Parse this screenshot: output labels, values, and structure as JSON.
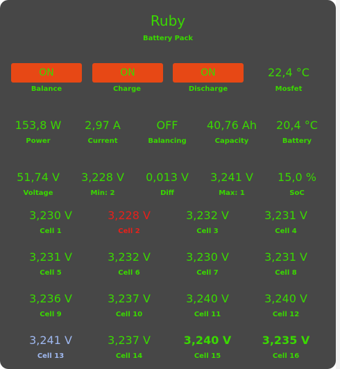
{
  "header": {
    "title": "Ruby",
    "subtitle": "Battery Pack"
  },
  "controls": [
    {
      "value": "ON",
      "label": "Balance"
    },
    {
      "value": "ON",
      "label": "Charge"
    },
    {
      "value": "ON",
      "label": "Discharge"
    }
  ],
  "mosfet": {
    "value": "22,4 °C",
    "label": "Mosfet"
  },
  "stats_row1": [
    {
      "value": "153,8 W",
      "label": "Power"
    },
    {
      "value": "2,97 A",
      "label": "Current"
    },
    {
      "value": "OFF",
      "label": "Balancing"
    },
    {
      "value": "40,76 Ah",
      "label": "Capacity"
    },
    {
      "value": "20,4 °C",
      "label": "Battery"
    }
  ],
  "stats_row2": [
    {
      "value": "51,74 V",
      "label": "Voltage"
    },
    {
      "value": "3,228 V",
      "label": "Min: 2"
    },
    {
      "value": "0,013 V",
      "label": "Diff"
    },
    {
      "value": "3,241 V",
      "label": "Max: 1"
    },
    {
      "value": "15,0 %",
      "label": "SoC"
    }
  ],
  "cells": [
    {
      "value": "3,230 V",
      "label": "Cell 1",
      "state": "normal"
    },
    {
      "value": "3,228 V",
      "label": "Cell 2",
      "state": "min"
    },
    {
      "value": "3,232 V",
      "label": "Cell 3",
      "state": "normal"
    },
    {
      "value": "3,231 V",
      "label": "Cell 4",
      "state": "normal"
    },
    {
      "value": "3,231 V",
      "label": "Cell 5",
      "state": "normal"
    },
    {
      "value": "3,232 V",
      "label": "Cell 6",
      "state": "normal"
    },
    {
      "value": "3,230 V",
      "label": "Cell 7",
      "state": "normal"
    },
    {
      "value": "3,231 V",
      "label": "Cell 8",
      "state": "normal"
    },
    {
      "value": "3,236 V",
      "label": "Cell 9",
      "state": "normal"
    },
    {
      "value": "3,237 V",
      "label": "Cell 10",
      "state": "normal"
    },
    {
      "value": "3,240 V",
      "label": "Cell 11",
      "state": "normal"
    },
    {
      "value": "3,240 V",
      "label": "Cell 12",
      "state": "normal"
    },
    {
      "value": "3,241 V",
      "label": "Cell 13",
      "state": "max"
    },
    {
      "value": "3,237 V",
      "label": "Cell 14",
      "state": "normal"
    },
    {
      "value": "3,240 V",
      "label": "Cell 15",
      "state": "bold"
    },
    {
      "value": "3,235 V",
      "label": "Cell 16",
      "state": "bold"
    }
  ],
  "colors": {
    "card": "#474747",
    "accent": "#3ad900",
    "button": "#e74815",
    "min": "#e8201a",
    "max": "#9fb8ef"
  }
}
